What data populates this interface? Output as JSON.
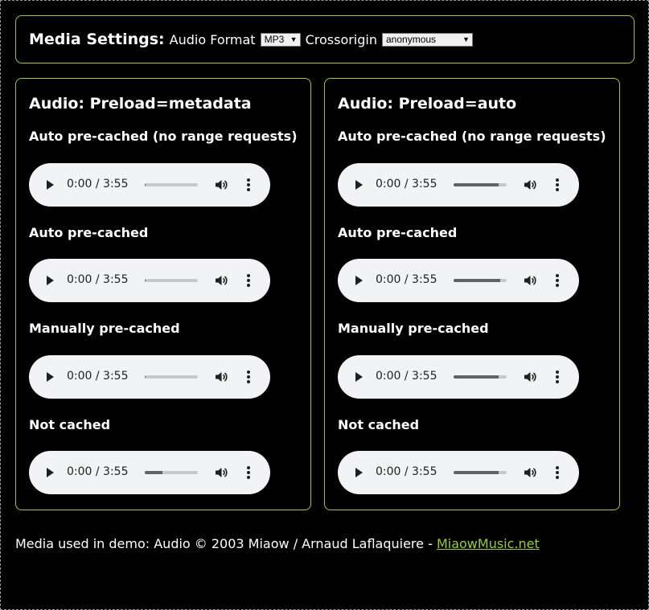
{
  "settings": {
    "heading": "Media Settings:",
    "audio_format_label": "Audio Format",
    "audio_format_value": "MP3",
    "crossorigin_label": "Crossorigin",
    "crossorigin_value": "anonymous"
  },
  "panels": [
    {
      "title": "Audio: Preload=metadata",
      "sections": [
        {
          "title": "Auto pre-cached (no range requests)",
          "time": "0:00 / 3:55",
          "buffered": 0.02
        },
        {
          "title": "Auto pre-cached",
          "time": "0:00 / 3:55",
          "buffered": 0.02
        },
        {
          "title": "Manually pre-cached",
          "time": "0:00 / 3:55",
          "buffered": 0.02
        },
        {
          "title": "Not cached",
          "time": "0:00 / 3:55",
          "buffered": 0.33
        }
      ]
    },
    {
      "title": "Audio: Preload=auto",
      "sections": [
        {
          "title": "Auto pre-cached (no range requests)",
          "time": "0:00 / 3:55",
          "buffered": 0.85
        },
        {
          "title": "Auto pre-cached",
          "time": "0:00 / 3:55",
          "buffered": 0.88
        },
        {
          "title": "Manually pre-cached",
          "time": "0:00 / 3:55",
          "buffered": 0.85
        },
        {
          "title": "Not cached",
          "time": "0:00 / 3:55",
          "buffered": 0.85
        }
      ]
    }
  ],
  "footer": {
    "text": "Media used in demo: Audio © 2003 Miaow / Arnaud Laflaquiere - ",
    "link_text": "MiaowMusic.net"
  },
  "colors": {
    "accent": "#9acd32",
    "background": "#000000",
    "player_bg": "#f1f3f4"
  }
}
